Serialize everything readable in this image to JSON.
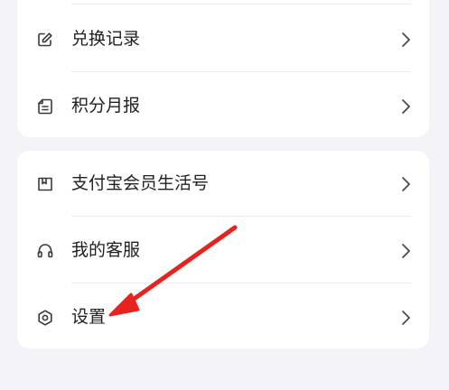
{
  "colors": {
    "background": "#f4f4f8",
    "card": "#ffffff",
    "text": "#1f1f1f",
    "icon": "#3a3a3a",
    "chevron": "#4a4a4a",
    "annotation_arrow": "#e8231f"
  },
  "group1": {
    "items": [
      {
        "label": "兑换记录",
        "icon": "edit-icon"
      },
      {
        "label": "积分月报",
        "icon": "report-icon"
      }
    ]
  },
  "group2": {
    "items": [
      {
        "label": "支付宝会员生活号",
        "icon": "book-icon"
      },
      {
        "label": "我的客服",
        "icon": "headset-icon"
      },
      {
        "label": "设置",
        "icon": "settings-icon"
      }
    ]
  },
  "annotation": {
    "type": "arrow",
    "points_to": "设置"
  }
}
